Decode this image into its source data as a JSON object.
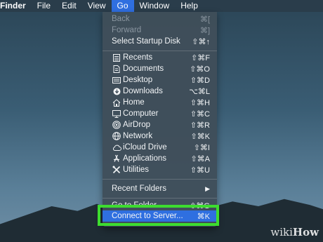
{
  "menubar": {
    "app": "Finder",
    "items": [
      "File",
      "Edit",
      "View",
      "Go",
      "Window",
      "Help"
    ]
  },
  "go_menu": {
    "back": {
      "label": "Back",
      "shortcut": "⌘["
    },
    "forward": {
      "label": "Forward",
      "shortcut": "⌘]"
    },
    "startup": {
      "label": "Select Startup Disk",
      "shortcut": "⇧⌘↑"
    },
    "places": [
      {
        "label": "Recents",
        "shortcut": "⇧⌘F",
        "icon": "recents-icon"
      },
      {
        "label": "Documents",
        "shortcut": "⇧⌘O",
        "icon": "documents-icon"
      },
      {
        "label": "Desktop",
        "shortcut": "⇧⌘D",
        "icon": "desktop-icon"
      },
      {
        "label": "Downloads",
        "shortcut": "⌥⌘L",
        "icon": "downloads-icon"
      },
      {
        "label": "Home",
        "shortcut": "⇧⌘H",
        "icon": "home-icon"
      },
      {
        "label": "Computer",
        "shortcut": "⇧⌘C",
        "icon": "computer-icon"
      },
      {
        "label": "AirDrop",
        "shortcut": "⇧⌘R",
        "icon": "airdrop-icon"
      },
      {
        "label": "Network",
        "shortcut": "⇧⌘K",
        "icon": "network-icon"
      },
      {
        "label": "iCloud Drive",
        "shortcut": "⇧⌘I",
        "icon": "icloud-icon"
      },
      {
        "label": "Applications",
        "shortcut": "⇧⌘A",
        "icon": "applications-icon"
      },
      {
        "label": "Utilities",
        "shortcut": "⇧⌘U",
        "icon": "utilities-icon"
      }
    ],
    "recent_folders": {
      "label": "Recent Folders",
      "arrow": "▶"
    },
    "go_to_folder": {
      "label": "Go to Folder...",
      "shortcut": "⇧⌘G"
    },
    "connect": {
      "label": "Connect to Server...",
      "shortcut": "⌘K"
    }
  },
  "watermark": {
    "part1": "wiki",
    "part2": "How"
  },
  "colors": {
    "highlight": "#2f6fe0",
    "callout": "#3ddc2f"
  }
}
